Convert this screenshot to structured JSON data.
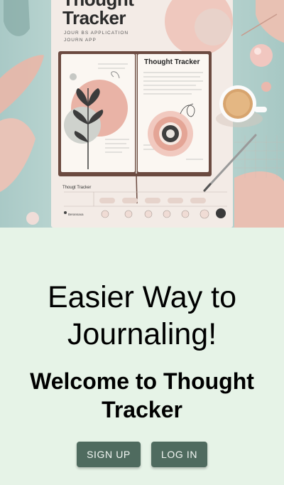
{
  "hero": {
    "poster_title": "Thought Tracker",
    "poster_subtitle_1": "JOUR BS APPLICATION",
    "poster_subtitle_2": "JOURN APP",
    "notebook_title": "Thought Tracker",
    "strip_title": "Thougt Tracker",
    "strip_footer": "Beransaxa"
  },
  "main": {
    "headline": "Easier Way to Journaling!",
    "welcome": "Welcome to Thought Tracker"
  },
  "actions": {
    "signup_label": "SIGN UP",
    "login_label": "LOG IN"
  },
  "colors": {
    "background": "#e6f3e7",
    "button": "#4f6b5f",
    "button_text": "#f4f8f5"
  }
}
